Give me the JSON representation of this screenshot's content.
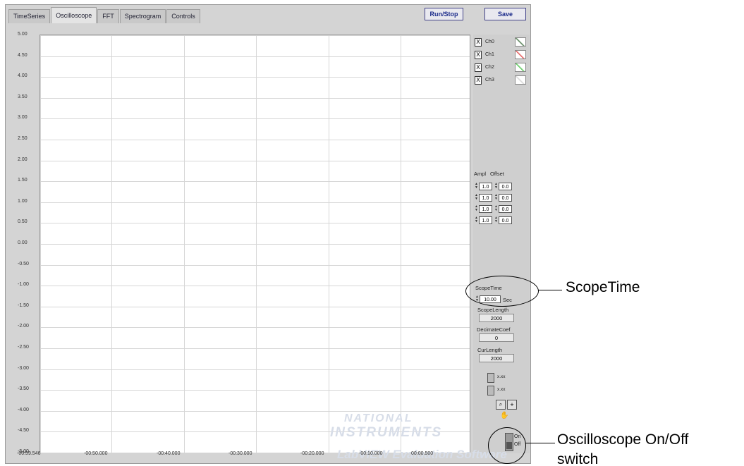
{
  "tabs": [
    {
      "label": "TimeSeries"
    },
    {
      "label": "Oscilloscope"
    },
    {
      "label": "FFT"
    },
    {
      "label": "Spectrogram"
    },
    {
      "label": "Controls"
    }
  ],
  "active_tab": "Oscilloscope",
  "toolbar": {
    "run_stop_label": "Run/Stop",
    "save_label": "Save"
  },
  "graph": {
    "y_ticks": [
      "5.00",
      "4.50",
      "4.00",
      "3.50",
      "3.00",
      "2.50",
      "2.00",
      "1.50",
      "1.00",
      "0.50",
      "0.00",
      "-0.50",
      "-1.00",
      "-1.50",
      "-2.00",
      "-2.50",
      "-3.00",
      "-3.50",
      "-4.00",
      "-4.50",
      "-5.00"
    ],
    "x_ticks": [
      "-00:59.546",
      "-00:50.000",
      "-00:40.000",
      "-00:30.000",
      "-00:20.000",
      "-00:10.000",
      "00:00.500"
    ]
  },
  "channels": [
    {
      "label": "Ch0",
      "checked_mark": "X",
      "color": "#3a6a3a"
    },
    {
      "label": "Ch1",
      "checked_mark": "X",
      "color": "#e04040"
    },
    {
      "label": "Ch2",
      "checked_mark": "X",
      "color": "#40c040"
    },
    {
      "label": "Ch3",
      "checked_mark": "X",
      "color": "#d0d0d0"
    }
  ],
  "ampl_offset": {
    "ampl_label": "Ampl",
    "offset_label": "Offset",
    "rows": [
      {
        "ampl": "1.0",
        "offset": "0.0"
      },
      {
        "ampl": "1.0",
        "offset": "0.0"
      },
      {
        "ampl": "1.0",
        "offset": "0.0"
      },
      {
        "ampl": "1.0",
        "offset": "0.0"
      }
    ]
  },
  "scope_time": {
    "label": "ScopeTime",
    "value": "10.00",
    "unit": "Sec"
  },
  "scope_length": {
    "label": "ScopeLength",
    "value": "2000"
  },
  "decimate_coef": {
    "label": "DecimateCoef",
    "value": "0"
  },
  "cur_length": {
    "label": "CurLength",
    "value": "2000"
  },
  "graph_tools": {
    "x_format": "x.xx",
    "y_format": "x.xx"
  },
  "power_switch": {
    "on_label": "On",
    "off_label": "Off"
  },
  "callouts": {
    "scope_time": "ScopeTime",
    "oscilloscope_switch_line1": "Oscilloscope On/Off",
    "oscilloscope_switch_line2": "switch"
  },
  "watermark": {
    "line1": "NATIONAL",
    "line2": "INSTRUMENTS",
    "line3": "LabVIEW Evaluation Software"
  }
}
